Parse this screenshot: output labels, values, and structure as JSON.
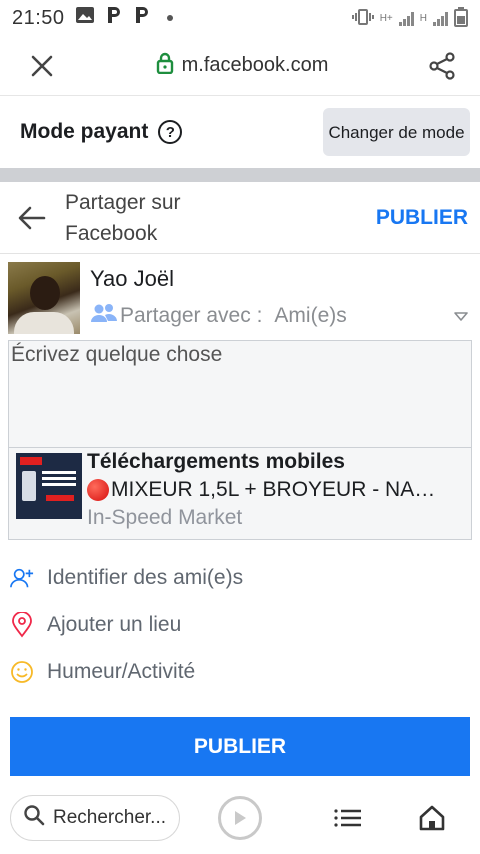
{
  "status_bar": {
    "time": "21:50",
    "network_label": "H+",
    "network_label2": "H"
  },
  "browser": {
    "url": "m.facebook.com",
    "icons": {
      "close": "close-icon",
      "lock": "lock-icon",
      "share": "share-icon"
    },
    "lock_color": "#1e8e3e"
  },
  "mode_bar": {
    "title": "Mode payant",
    "help_glyph": "?",
    "change_mode_label": "Changer de mode"
  },
  "share_header": {
    "title": "Partager sur Facebook",
    "publish_label": "PUBLIER"
  },
  "user": {
    "name": "Yao Joël",
    "audience_label": "Partager avec :",
    "audience_value": "Ami(e)s"
  },
  "composer": {
    "placeholder": "Écrivez quelque chose"
  },
  "link_preview": {
    "title": "Téléchargements mobiles",
    "description": "MIXEUR 1,5L + BROYEUR - NA…",
    "source": "In-Speed Market"
  },
  "actions": [
    {
      "label": "Identifier des ami(e)s",
      "icon": "tag-friends-icon",
      "color": "#1877f2"
    },
    {
      "label": "Ajouter un lieu",
      "icon": "location-pin-icon",
      "color": "#f02849"
    },
    {
      "label": "Humeur/Activité",
      "icon": "smiley-icon",
      "color": "#f7b928"
    }
  ],
  "publish_button": {
    "label": "PUBLIER",
    "color": "#1877f2"
  },
  "bottom_bar": {
    "search_placeholder": "Rechercher..."
  }
}
